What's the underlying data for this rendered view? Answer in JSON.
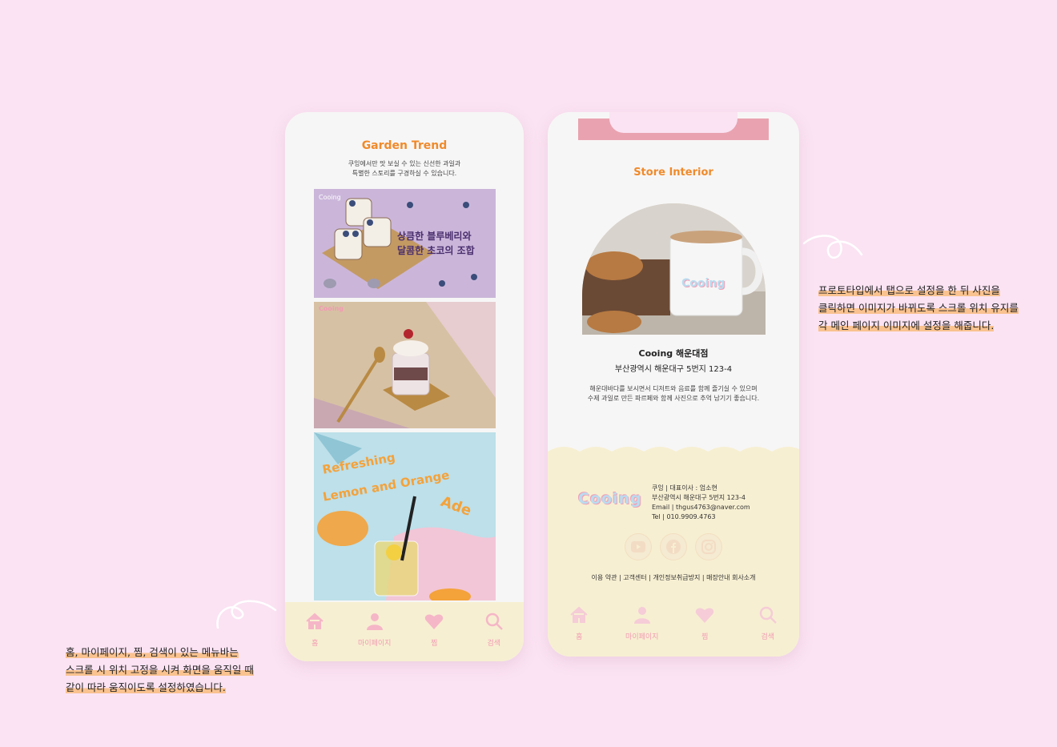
{
  "left_phone": {
    "title": "Garden Trend",
    "description_line1": "쿠잉에서만 맛 보실 수 있는 신선한 과일과",
    "description_line2": "특별한 스토리를 구경하실 수 있습니다.",
    "card1": {
      "brand": "Cooing",
      "headline1": "상큼한 블루베리와",
      "headline2": "달콤한 초코의 조합"
    },
    "card2": {
      "brand": "Cooing"
    },
    "card3": {
      "line1": "Refreshing",
      "line2": "Lemon and Orange",
      "line3": "Ade"
    },
    "nav": [
      {
        "label": "홈",
        "icon": "home-icon"
      },
      {
        "label": "마이페이지",
        "icon": "user-icon"
      },
      {
        "label": "찜",
        "icon": "heart-icon"
      },
      {
        "label": "검색",
        "icon": "search-icon"
      }
    ]
  },
  "right_phone": {
    "title": "Store Interior",
    "mug_text": "Cooing",
    "store_name": "Cooing 해운대점",
    "store_address": "부산광역시 해운대구 5번지 123-4",
    "desc_line1": "해운대바다를 보시면서 디저트와 음료를 함께 즐기실 수 있으며",
    "desc_line2": "수제 과일로 만든 파르페와 함께 사진으로 추억 남기기 좋습니다.",
    "footer": {
      "logo": "Cooing",
      "info1": "쿠잉 | 대표이사 : 엄소현",
      "info2": "부산광역시 해운대구 5번지 123-4",
      "info3": "Email | thgus4763@naver.com",
      "info4": "Tel | 010.9909.4763",
      "social": [
        "youtube-icon",
        "facebook-icon",
        "instagram-icon"
      ],
      "links": "이용 약관 | 고객센터 | 개인정보취급방지 | 매장안내 회사소개"
    },
    "nav": [
      {
        "label": "홈",
        "icon": "home-icon"
      },
      {
        "label": "마이페이지",
        "icon": "user-icon"
      },
      {
        "label": "찜",
        "icon": "heart-icon"
      },
      {
        "label": "검색",
        "icon": "search-icon"
      }
    ]
  },
  "annotations": {
    "right_line1": "프로토타입에서 탭으로 설정을 한 뒤 사진을",
    "right_line2": "클릭하면 이미지가 바뀌도록 스크롤 위치 유지를",
    "right_line3": "각 메인 페이지 이미지에 설정을 해줍니다.",
    "left_line1": "홈, 마이페이지, 찜, 검색이 있는 메뉴바는",
    "left_line2": "스크롤 시 위치 고정을 시켜 화면을 움직일 때",
    "left_line3": "같이 따라 움직이도록 설정하였습니다."
  },
  "colors": {
    "background": "#fbe3f3",
    "accent_orange": "#f08a2a",
    "nav_pink": "#f29ab3",
    "footer_cream": "#f7efd2",
    "highlight": "#f9c28f"
  }
}
